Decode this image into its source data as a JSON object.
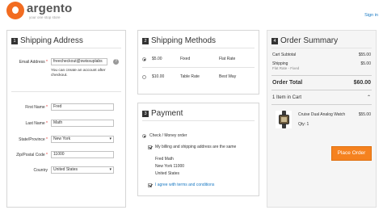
{
  "header": {
    "logo_name": "argento",
    "logo_tagline": "your one stop store",
    "sign_in": "Sign in"
  },
  "shipping_address": {
    "step": "1",
    "title": "Shipping Address",
    "email_label": "Email Address",
    "email_value": "freecheckout@swissuplabs",
    "email_note_1": "You can create an account after",
    "email_note_2": "checkout.",
    "first_name_label": "First Name",
    "first_name_value": "Fred",
    "last_name_label": "Last Name",
    "last_name_value": "Math",
    "state_label": "State/Province",
    "state_value": "New York",
    "zip_label": "Zip/Postal Code",
    "zip_value": "11000",
    "country_label": "Country",
    "country_value": "United States",
    "required_mark": "*",
    "help_icon": "question-icon"
  },
  "shipping_methods": {
    "step": "2",
    "title": "Shipping Methods",
    "options": [
      {
        "price": "$5.00",
        "type": "Fixed",
        "carrier": "Flat Rate",
        "selected": true
      },
      {
        "price": "$10.00",
        "type": "Table Rate",
        "carrier": "Best Way",
        "selected": false
      }
    ]
  },
  "payment": {
    "step": "3",
    "title": "Payment",
    "method_label": "Check / Money order",
    "same_address_label": "My billing and shipping address are the same",
    "address_name": "Fred Math",
    "address_city": "New York 11000",
    "address_country": "United States",
    "terms_label": "I agree with terms and conditions"
  },
  "order_summary": {
    "step": "4",
    "title": "Order Summary",
    "subtotal_label": "Cart Subtotal",
    "subtotal_value": "$55.00",
    "shipping_label": "Shipping",
    "shipping_method": "Flat Rate - Fixed",
    "shipping_value": "$5.00",
    "total_label": "Order Total",
    "total_value": "$60.00",
    "items_in_cart": "1 Item in Cart",
    "item": {
      "name": "Cruise Dual Analog Watch",
      "qty": "Qty: 1",
      "price": "$55.00"
    },
    "place_order": "Place Order"
  },
  "colors": {
    "accent": "#f5821f",
    "link": "#1979c3",
    "logo": "#f26c21"
  }
}
